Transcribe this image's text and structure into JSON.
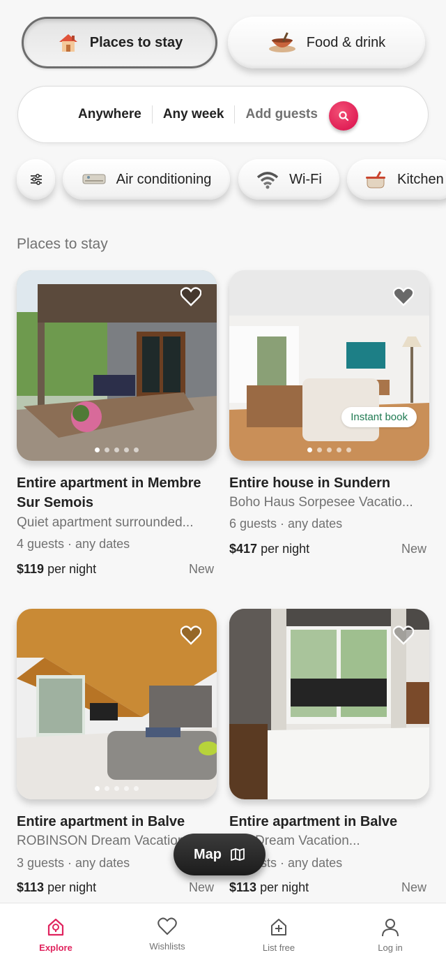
{
  "categories": [
    {
      "label": "Places to stay",
      "icon": "house-icon",
      "active": true
    },
    {
      "label": "Food & drink",
      "icon": "food-bowl-icon",
      "active": false
    }
  ],
  "search": {
    "where": "Anywhere",
    "when": "Any week",
    "who": "Add guests"
  },
  "filters": [
    {
      "label": "Air conditioning",
      "icon": "air-conditioner-icon"
    },
    {
      "label": "Wi-Fi",
      "icon": "wifi-icon"
    },
    {
      "label": "Kitchen",
      "icon": "kitchen-pot-icon"
    }
  ],
  "section_title": "Places to stay",
  "listings": [
    {
      "title": "Entire apartment in Membre Sur Semois",
      "subtitle": "Quiet apartment surrounded...",
      "guests": "4 guests",
      "dates": "any dates",
      "price": "$119",
      "price_suffix": "per night",
      "tag": "New",
      "badge": ""
    },
    {
      "title": "Entire house in Sundern",
      "subtitle": "Boho Haus Sorpesee Vacatio...",
      "guests": "6 guests",
      "dates": "any dates",
      "price": "$417",
      "price_suffix": "per night",
      "tag": "New",
      "badge": "Instant book"
    },
    {
      "title": "Entire apartment in Balve",
      "subtitle": "ROBINSON Dream Vacation...",
      "guests": "3 guests",
      "dates": "any dates",
      "price": "$113",
      "price_suffix": "per night",
      "tag": "New",
      "badge": ""
    },
    {
      "title": "Entire apartment in Balve",
      "subtitle": "Loft Dream Vacation...",
      "guests": "4 guests",
      "dates": "any dates",
      "price": "$113",
      "price_suffix": "per night",
      "tag": "New",
      "badge": ""
    }
  ],
  "map_button": "Map",
  "nav": [
    {
      "label": "Explore",
      "icon": "explore-icon",
      "active": true
    },
    {
      "label": "Wishlists",
      "icon": "heart-icon",
      "active": false
    },
    {
      "label": "List free",
      "icon": "list-house-icon",
      "active": false
    },
    {
      "label": "Log in",
      "icon": "person-icon",
      "active": false
    }
  ],
  "colors": {
    "brand": "#e0245e",
    "instant_book": "#1f7a52"
  }
}
